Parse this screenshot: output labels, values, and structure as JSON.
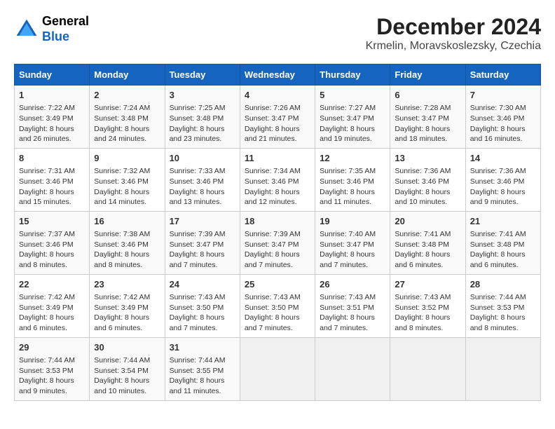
{
  "header": {
    "logo_general": "General",
    "logo_blue": "Blue",
    "title": "December 2024",
    "subtitle": "Krmelin, Moravskoslezsky, Czechia"
  },
  "calendar": {
    "weekdays": [
      "Sunday",
      "Monday",
      "Tuesday",
      "Wednesday",
      "Thursday",
      "Friday",
      "Saturday"
    ],
    "weeks": [
      [
        {
          "day": "1",
          "sunrise": "Sunrise: 7:22 AM",
          "sunset": "Sunset: 3:49 PM",
          "daylight": "Daylight: 8 hours and 26 minutes."
        },
        {
          "day": "2",
          "sunrise": "Sunrise: 7:24 AM",
          "sunset": "Sunset: 3:48 PM",
          "daylight": "Daylight: 8 hours and 24 minutes."
        },
        {
          "day": "3",
          "sunrise": "Sunrise: 7:25 AM",
          "sunset": "Sunset: 3:48 PM",
          "daylight": "Daylight: 8 hours and 23 minutes."
        },
        {
          "day": "4",
          "sunrise": "Sunrise: 7:26 AM",
          "sunset": "Sunset: 3:47 PM",
          "daylight": "Daylight: 8 hours and 21 minutes."
        },
        {
          "day": "5",
          "sunrise": "Sunrise: 7:27 AM",
          "sunset": "Sunset: 3:47 PM",
          "daylight": "Daylight: 8 hours and 19 minutes."
        },
        {
          "day": "6",
          "sunrise": "Sunrise: 7:28 AM",
          "sunset": "Sunset: 3:47 PM",
          "daylight": "Daylight: 8 hours and 18 minutes."
        },
        {
          "day": "7",
          "sunrise": "Sunrise: 7:30 AM",
          "sunset": "Sunset: 3:46 PM",
          "daylight": "Daylight: 8 hours and 16 minutes."
        }
      ],
      [
        {
          "day": "8",
          "sunrise": "Sunrise: 7:31 AM",
          "sunset": "Sunset: 3:46 PM",
          "daylight": "Daylight: 8 hours and 15 minutes."
        },
        {
          "day": "9",
          "sunrise": "Sunrise: 7:32 AM",
          "sunset": "Sunset: 3:46 PM",
          "daylight": "Daylight: 8 hours and 14 minutes."
        },
        {
          "day": "10",
          "sunrise": "Sunrise: 7:33 AM",
          "sunset": "Sunset: 3:46 PM",
          "daylight": "Daylight: 8 hours and 13 minutes."
        },
        {
          "day": "11",
          "sunrise": "Sunrise: 7:34 AM",
          "sunset": "Sunset: 3:46 PM",
          "daylight": "Daylight: 8 hours and 12 minutes."
        },
        {
          "day": "12",
          "sunrise": "Sunrise: 7:35 AM",
          "sunset": "Sunset: 3:46 PM",
          "daylight": "Daylight: 8 hours and 11 minutes."
        },
        {
          "day": "13",
          "sunrise": "Sunrise: 7:36 AM",
          "sunset": "Sunset: 3:46 PM",
          "daylight": "Daylight: 8 hours and 10 minutes."
        },
        {
          "day": "14",
          "sunrise": "Sunrise: 7:36 AM",
          "sunset": "Sunset: 3:46 PM",
          "daylight": "Daylight: 8 hours and 9 minutes."
        }
      ],
      [
        {
          "day": "15",
          "sunrise": "Sunrise: 7:37 AM",
          "sunset": "Sunset: 3:46 PM",
          "daylight": "Daylight: 8 hours and 8 minutes."
        },
        {
          "day": "16",
          "sunrise": "Sunrise: 7:38 AM",
          "sunset": "Sunset: 3:46 PM",
          "daylight": "Daylight: 8 hours and 8 minutes."
        },
        {
          "day": "17",
          "sunrise": "Sunrise: 7:39 AM",
          "sunset": "Sunset: 3:47 PM",
          "daylight": "Daylight: 8 hours and 7 minutes."
        },
        {
          "day": "18",
          "sunrise": "Sunrise: 7:39 AM",
          "sunset": "Sunset: 3:47 PM",
          "daylight": "Daylight: 8 hours and 7 minutes."
        },
        {
          "day": "19",
          "sunrise": "Sunrise: 7:40 AM",
          "sunset": "Sunset: 3:47 PM",
          "daylight": "Daylight: 8 hours and 7 minutes."
        },
        {
          "day": "20",
          "sunrise": "Sunrise: 7:41 AM",
          "sunset": "Sunset: 3:48 PM",
          "daylight": "Daylight: 8 hours and 6 minutes."
        },
        {
          "day": "21",
          "sunrise": "Sunrise: 7:41 AM",
          "sunset": "Sunset: 3:48 PM",
          "daylight": "Daylight: 8 hours and 6 minutes."
        }
      ],
      [
        {
          "day": "22",
          "sunrise": "Sunrise: 7:42 AM",
          "sunset": "Sunset: 3:49 PM",
          "daylight": "Daylight: 8 hours and 6 minutes."
        },
        {
          "day": "23",
          "sunrise": "Sunrise: 7:42 AM",
          "sunset": "Sunset: 3:49 PM",
          "daylight": "Daylight: 8 hours and 6 minutes."
        },
        {
          "day": "24",
          "sunrise": "Sunrise: 7:43 AM",
          "sunset": "Sunset: 3:50 PM",
          "daylight": "Daylight: 8 hours and 7 minutes."
        },
        {
          "day": "25",
          "sunrise": "Sunrise: 7:43 AM",
          "sunset": "Sunset: 3:50 PM",
          "daylight": "Daylight: 8 hours and 7 minutes."
        },
        {
          "day": "26",
          "sunrise": "Sunrise: 7:43 AM",
          "sunset": "Sunset: 3:51 PM",
          "daylight": "Daylight: 8 hours and 7 minutes."
        },
        {
          "day": "27",
          "sunrise": "Sunrise: 7:43 AM",
          "sunset": "Sunset: 3:52 PM",
          "daylight": "Daylight: 8 hours and 8 minutes."
        },
        {
          "day": "28",
          "sunrise": "Sunrise: 7:44 AM",
          "sunset": "Sunset: 3:53 PM",
          "daylight": "Daylight: 8 hours and 8 minutes."
        }
      ],
      [
        {
          "day": "29",
          "sunrise": "Sunrise: 7:44 AM",
          "sunset": "Sunset: 3:53 PM",
          "daylight": "Daylight: 8 hours and 9 minutes."
        },
        {
          "day": "30",
          "sunrise": "Sunrise: 7:44 AM",
          "sunset": "Sunset: 3:54 PM",
          "daylight": "Daylight: 8 hours and 10 minutes."
        },
        {
          "day": "31",
          "sunrise": "Sunrise: 7:44 AM",
          "sunset": "Sunset: 3:55 PM",
          "daylight": "Daylight: 8 hours and 11 minutes."
        },
        null,
        null,
        null,
        null
      ]
    ]
  }
}
